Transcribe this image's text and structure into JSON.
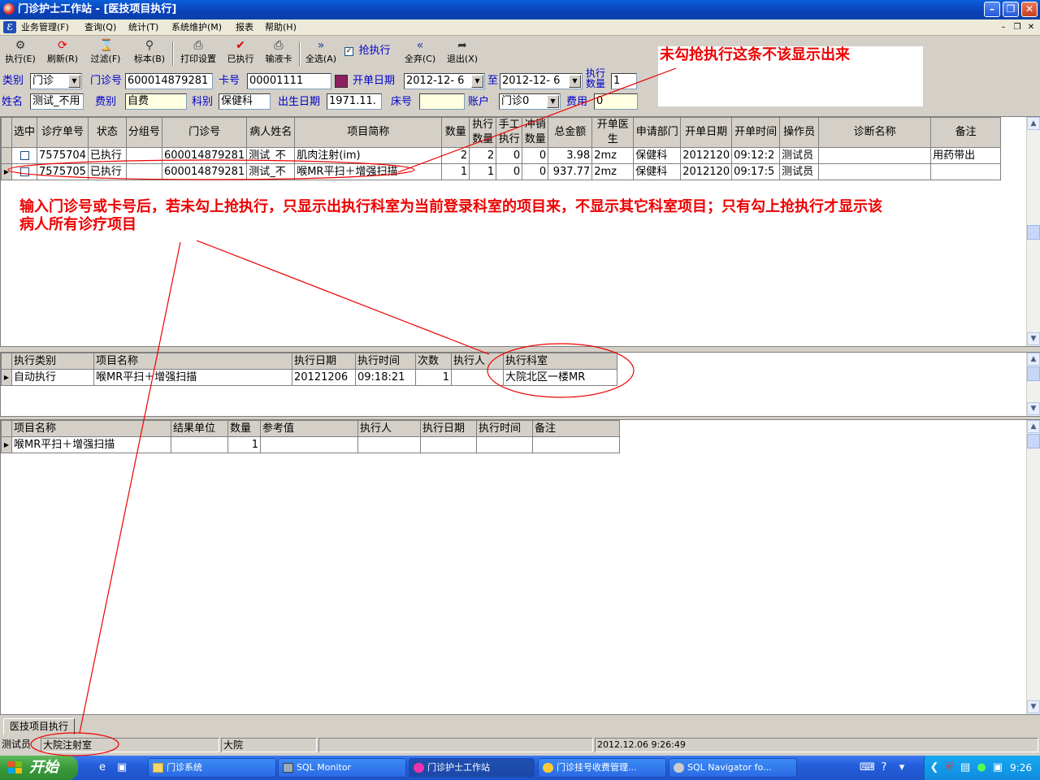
{
  "window": {
    "title": "门诊护士工作站 - [医技项目执行]"
  },
  "menu": [
    "业务管理(F)",
    "查询(Q)",
    "统计(T)",
    "系统维护(M)",
    "报表",
    "帮助(H)"
  ],
  "toolbar": {
    "execute": "执行(E)",
    "refresh": "刷新(R)",
    "filter": "过滤(F)",
    "mark": "标本(B)",
    "print_setup": "打印设置",
    "executed": "已执行",
    "infusion_card": "输液卡",
    "select_all": "全选(A)",
    "rush_execute": "抢执行",
    "rush_checked": "✓",
    "deselect_all": "全弃(C)",
    "exit": "退出(X)"
  },
  "form": {
    "category_label": "类别",
    "category_value": "门诊",
    "outpatient_no_label": "门诊号",
    "outpatient_no_value": "600014879281",
    "card_no_label": "卡号",
    "card_no_value": "00001111",
    "order_date_label": "开单日期",
    "date_from": "2012-12- 6",
    "to_label": "至",
    "date_to": "2012-12- 6",
    "exec_count_label": "执行数量",
    "exec_count_value": "1",
    "name_label": "姓名",
    "name_value": "测试_不用",
    "fee_type_label": "费别",
    "fee_type_value": "自费",
    "dept_label": "科别",
    "dept_value": "保健科",
    "birth_label": "出生日期",
    "birth_value": "1971.11.",
    "bed_label": "床号",
    "bed_value": "",
    "account_label": "账户",
    "account_value": "门诊0",
    "fee_label": "费用",
    "fee_value": "0"
  },
  "annotation_top": "未勾抢执行这条不该显示出来",
  "annotation_middle": "输入门诊号或卡号后，若未勾上抢执行，只显示出执行科室为当前登录科室的项目来，不显示其它科室项目；只有勾上抢执行才显示该病人所有诊疗项目",
  "main_grid": {
    "headers": [
      "选中",
      "诊疗单号",
      "状态",
      "分组号",
      "门诊号",
      "病人姓名",
      "项目简称",
      "数量",
      "执行数量",
      "手工执行",
      "冲销数量",
      "总金额",
      "开单医生",
      "申请部门",
      "开单日期",
      "开单时间",
      "操作员",
      "诊断名称",
      "备注"
    ],
    "rows": [
      [
        "",
        "7575704",
        "已执行",
        "",
        "600014879281",
        "测试_不",
        "肌肉注射(im)",
        "2",
        "2",
        "0",
        "0",
        "3.98",
        "2mz",
        "保健科",
        "2012120",
        "09:12:2",
        "测试员",
        "",
        "用药带出"
      ],
      [
        "",
        "7575705",
        "已执行",
        "",
        "600014879281",
        "测试_不",
        "喉MR平扫＋增强扫描",
        "1",
        "1",
        "0",
        "0",
        "937.77",
        "2mz",
        "保健科",
        "2012120",
        "09:17:5",
        "测试员",
        "",
        ""
      ]
    ]
  },
  "exec_grid": {
    "headers": [
      "执行类别",
      "项目名称",
      "执行日期",
      "执行时间",
      "次数",
      "执行人",
      "执行科室"
    ],
    "rows": [
      [
        "自动执行",
        "喉MR平扫＋增强扫描",
        "20121206",
        "09:18:21",
        "1",
        "",
        "大院北区一楼MR"
      ]
    ]
  },
  "result_grid": {
    "headers": [
      "项目名称",
      "结果单位",
      "数量",
      "参考值",
      "执行人",
      "执行日期",
      "执行时间",
      "备注"
    ],
    "rows": [
      [
        "喉MR平扫＋增强扫描",
        "",
        "1",
        "",
        "",
        "",
        "",
        ""
      ]
    ]
  },
  "tab": "医技项目执行",
  "status": {
    "user": "测试员",
    "dept": "大院注射室",
    "campus": "大院",
    "datetime": "2012.12.06 9:26:49"
  },
  "taskbar": {
    "start": "开始",
    "tasks": [
      "门诊系统",
      "SQL Monitor",
      "门诊护士工作站",
      "门诊挂号收费管理...",
      "SQL Navigator fo..."
    ],
    "clock": "9:26"
  },
  "colors": {
    "annotation": "#e00000",
    "label_blue": "#0000c8",
    "xp_blue": "#0a5fd8"
  }
}
